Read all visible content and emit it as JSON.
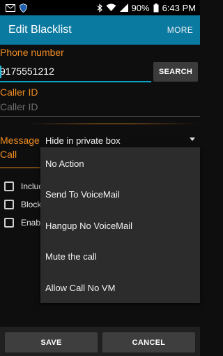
{
  "status_bar": {
    "battery": "90%",
    "time": "6:43 PM",
    "left_icons": [
      "mail-icon",
      "shield-icon"
    ],
    "right_icons": [
      "bluetooth-icon",
      "wifi-icon",
      "signal-icon",
      "battery-icon"
    ]
  },
  "app_bar": {
    "title": "Edit Blacklist",
    "more_label": "MORE",
    "color": "#0b7aa0"
  },
  "form": {
    "phone_label": "Phone number",
    "phone_value": "9175551212",
    "search_label": "SEARCH",
    "caller_id_label": "Caller ID",
    "caller_id_placeholder": "Caller ID",
    "message_label": "Message",
    "call_label": "Call",
    "message_selected": "Hide in private box",
    "checkboxes": [
      {
        "label": "Include",
        "checked": false
      },
      {
        "label": "Block c",
        "checked": false
      },
      {
        "label": "Enable",
        "checked": false
      }
    ]
  },
  "dropdown": {
    "options": [
      "No Action",
      "Send To VoiceMail",
      "Hangup No VoiceMail",
      "Mute the call",
      "Allow Call No VM"
    ]
  },
  "bottom_bar": {
    "save_label": "SAVE",
    "cancel_label": "CANCEL"
  },
  "colors": {
    "accent_orange": "#f08c21",
    "accent_cyan": "#0aa3c9",
    "background": "#0e0e0e"
  }
}
